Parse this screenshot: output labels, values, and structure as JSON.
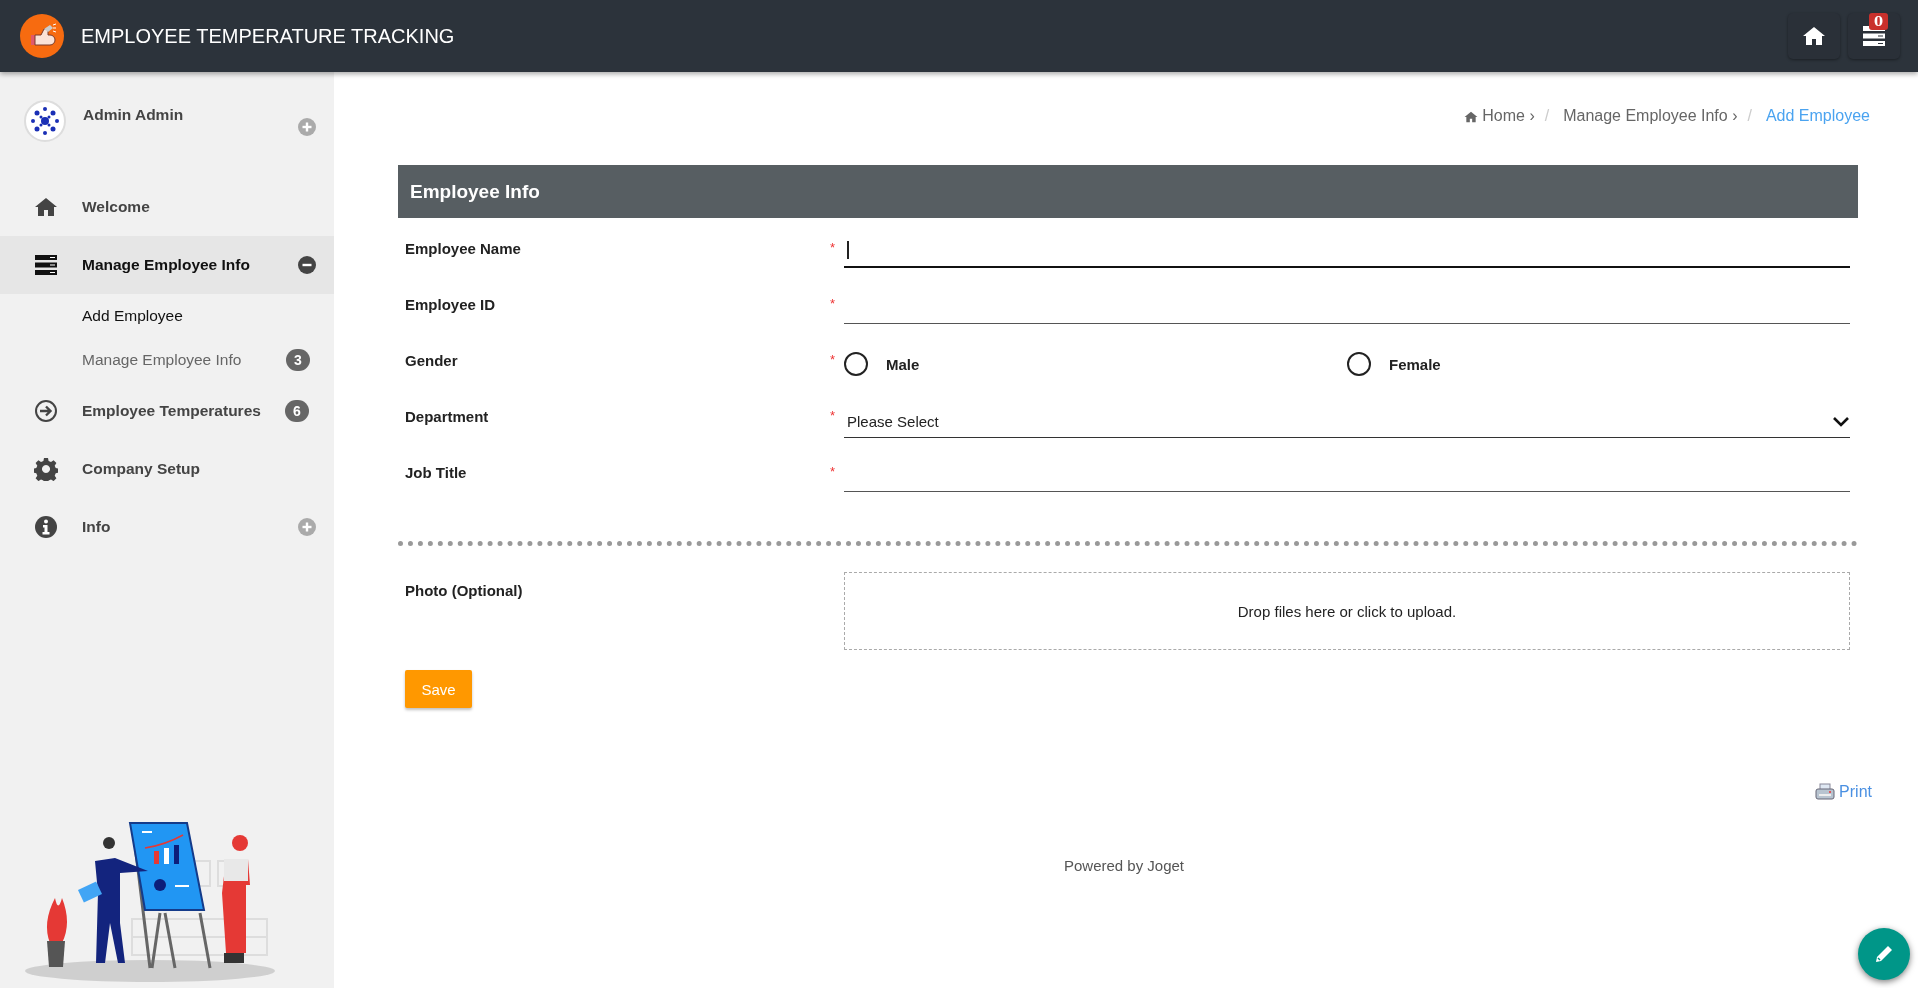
{
  "header": {
    "title": "EMPLOYEE TEMPERATURE TRACKING",
    "notification_count": "0"
  },
  "sidebar": {
    "profile": {
      "name": "Admin Admin",
      "expanded": false
    },
    "items": [
      {
        "label": "Welcome",
        "selected": false
      },
      {
        "label": "Manage Employee Info",
        "selected": true,
        "expanded": true,
        "children": [
          {
            "label": "Add Employee",
            "selected": true
          },
          {
            "label": "Manage Employee Info",
            "selected": false,
            "badge": "3"
          }
        ]
      },
      {
        "label": "Employee Temperatures",
        "selected": false,
        "badge": "6"
      },
      {
        "label": "Company Setup",
        "selected": false
      },
      {
        "label": "Info",
        "selected": false,
        "expanded": false
      }
    ]
  },
  "breadcrumb": {
    "separator": "/",
    "items": [
      {
        "label": "Home",
        "arrow": "›",
        "current": false
      },
      {
        "label": "Manage Employee Info",
        "arrow": "›",
        "current": false
      },
      {
        "label": "Add Employee",
        "current": true
      }
    ]
  },
  "form": {
    "title": "Employee Info",
    "fields": [
      {
        "kind": "text",
        "label": "Employee Name",
        "required_mark": "*",
        "focused": true
      },
      {
        "kind": "text",
        "label": "Employee ID",
        "required_mark": "*",
        "focused": false
      },
      {
        "kind": "radio",
        "label": "Gender",
        "required_mark": "*",
        "options": [
          {
            "label": "Male",
            "selected": false
          },
          {
            "label": "Female",
            "selected": false
          }
        ]
      },
      {
        "kind": "select",
        "label": "Department",
        "required_mark": "*",
        "value": "Please Select"
      },
      {
        "kind": "text",
        "label": "Job Title",
        "required_mark": "*",
        "focused": false
      }
    ],
    "photo": {
      "label": "Photo (Optional)",
      "hint": "Drop files here or click to upload."
    },
    "save_button": "Save"
  },
  "print_link": "Print",
  "footer": "Powered by Joget"
}
